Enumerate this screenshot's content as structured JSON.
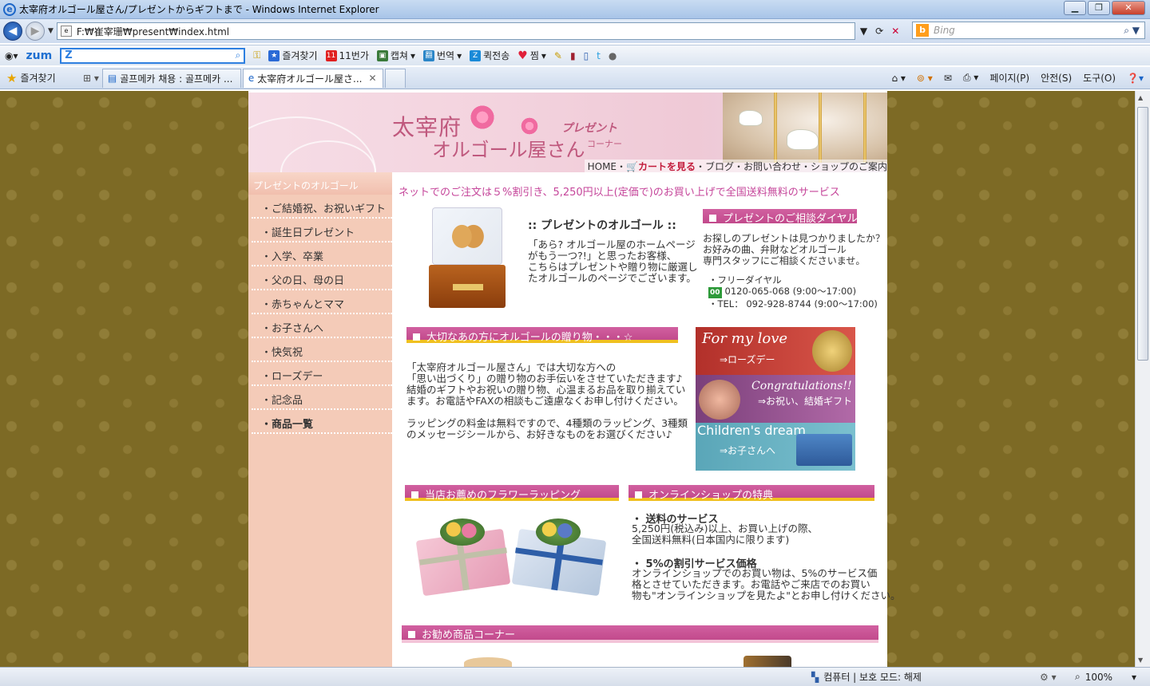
{
  "browser": {
    "window_title": "太宰府オルゴール屋さん/プレゼントからギフトまで - Windows Internet Explorer",
    "address": "F:₩崔宰珊₩present₩index.html",
    "search_placeholder": "Bing",
    "toolbar": {
      "zum_logo": "zum",
      "items": [
        "즐겨찾기",
        "11번가",
        "캡쳐",
        "번역",
        "퀵전송",
        "찜"
      ]
    },
    "favorites_label": "즐겨찾기",
    "tabs": [
      {
        "label": "골프메카 채용 : 골프메카 ..."
      },
      {
        "label": "太宰府オルゴール屋さ..."
      }
    ],
    "tab_tools": [
      "페이지(P)",
      "안전(S)",
      "도구(O)"
    ],
    "status": {
      "zone": "컴퓨터 | 보호 모드: 해제",
      "zoom": "100%"
    }
  },
  "site": {
    "banner": {
      "title_line1": "太宰府",
      "title_line2": "オルゴール屋さん",
      "sub1": "プレゼント",
      "sub2": "コーナー"
    },
    "topnav": {
      "home": "HOME",
      "cart": "カートを見る",
      "rest": "・ブログ・お問い合わせ・ショップのご案内"
    },
    "sidebar": {
      "heading": "プレゼントのオルゴール",
      "items": [
        "・ご結婚祝、お祝いギフト",
        "・誕生日プレゼント",
        "・入学、卒業",
        "・父の日、母の日",
        "・赤ちゃんとママ",
        "・お子さんへ",
        "・快気祝",
        "・ローズデー",
        "・記念品",
        "・商品一覧"
      ]
    },
    "notice": "ネットでのご注文は５%割引き、5,250円以上(定価で)のお買い上げで全国送料無料のサービス",
    "intro": {
      "title": ":: プレゼントのオルゴール ::",
      "lines": [
        "「あら? オルゴール屋のホームページ",
        "がもう一つ?!」と思ったお客様、",
        "こちらはプレゼントや贈り物に厳選し",
        "たオルゴールのページでございます。"
      ]
    },
    "dial": {
      "heading": "プレゼントのご相談ダイヤル",
      "lines": [
        "お探しのプレゼントは見つかりましたか？",
        "お好みの曲、弁財などオルゴール",
        "専門スタッフにご相談くださいませ。"
      ],
      "free_label": "・フリーダイヤル",
      "free_badge": "00",
      "free_number": "0120-065-068 (9:00～17:00)",
      "tel": "・TEL：  092-928-8744 (9:00～17:00)"
    },
    "gift_section": {
      "heading": "大切なあの方にオルゴールの贈り物・・・☆",
      "para1": [
        "「太宰府オルゴール屋さん」では大切な方への",
        "「思い出づくり」の贈り物のお手伝いをさせていただきます♪",
        "結婚のギフトやお祝いの贈り物、心温まるお品を取り揃えてい",
        "ます。お電話やFAXの相談もご遠慮なくお申し付けください。"
      ],
      "para2": [
        "ラッピングの料金は無料ですので、4種類のラッピング、3種類",
        "のメッセージシールから、お好きなものをお選びください♪"
      ]
    },
    "promos": [
      {
        "main": "For my love",
        "sub": "⇒ローズデー",
        "color": "#b83a2e"
      },
      {
        "main": "Congratulations!!",
        "sub": "⇒お祝い、結婚ギフト",
        "color": "#8e4d8c"
      },
      {
        "main": "Children's dream",
        "sub": "⇒お子さんへ",
        "color": "#5aa6b8"
      }
    ],
    "flower_section": {
      "heading": "当店お薦めのフラワーラッピング"
    },
    "online_section": {
      "heading": "オンラインショップの特典",
      "shipping_title": "・ 送料のサービス",
      "shipping_lines": [
        "5,250円(税込み)以上、お買い上げの際、",
        "全国送料無料(日本国内に限ります)"
      ],
      "discount_title": "・ 5%の割引サービス価格",
      "discount_lines": [
        "オンラインショップでのお買い物は、5%のサービス価",
        "格とさせていただきます。お電話やご来店でのお買い",
        "物も\"オンラインショップを見たよ\"とお申し付けください。"
      ]
    },
    "recommend_section": {
      "heading": "お勧め商品コーナー"
    }
  }
}
